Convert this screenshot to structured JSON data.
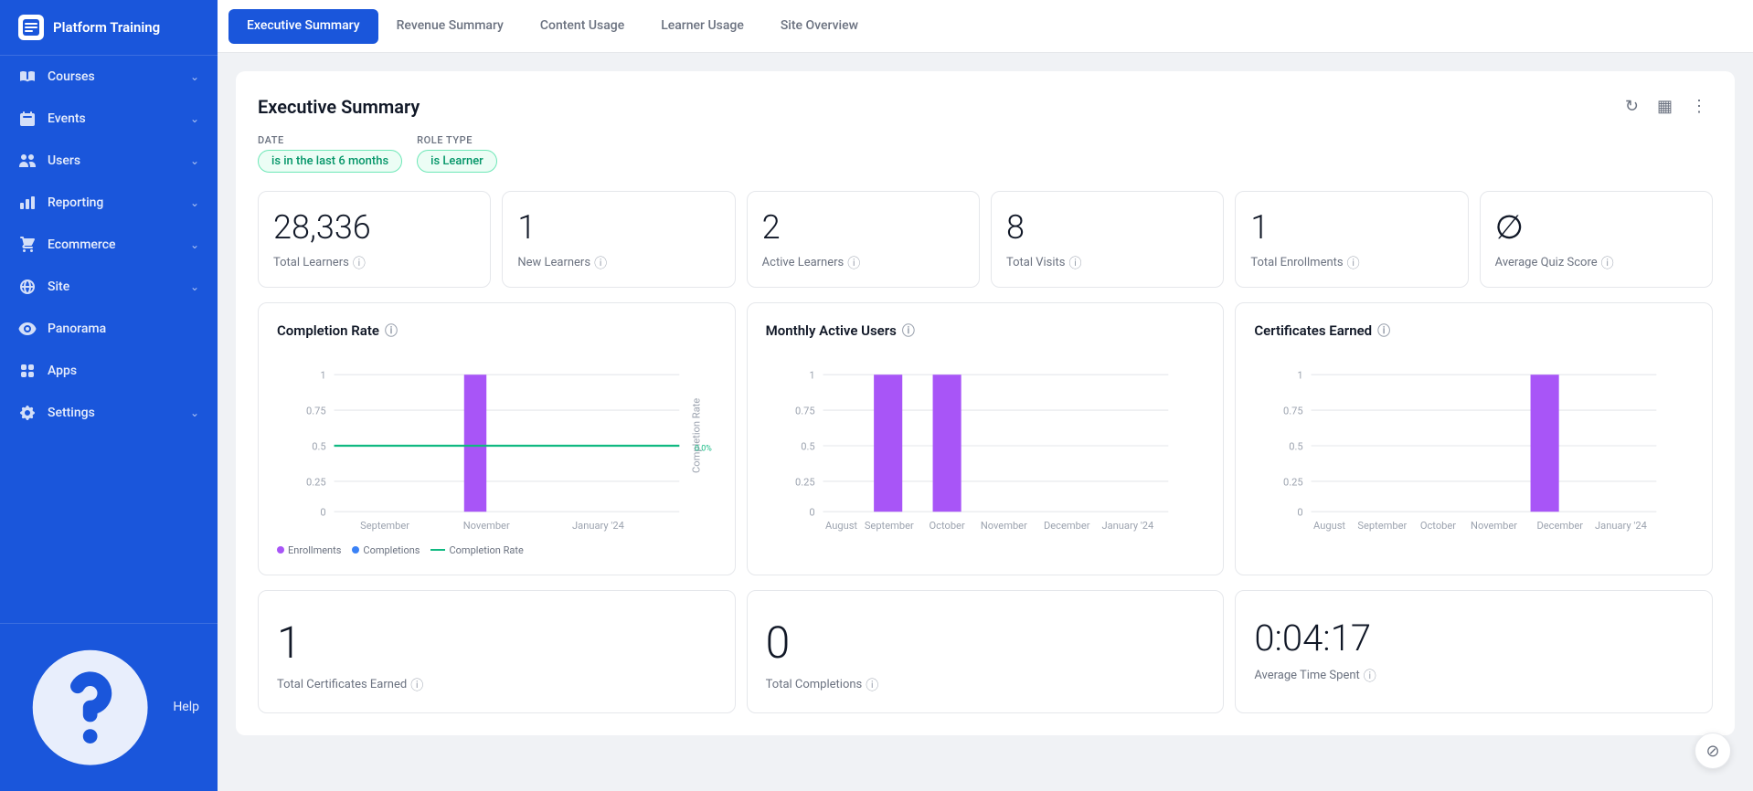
{
  "sidebar": {
    "title": "Platform Training",
    "items": [
      {
        "label": "Courses",
        "icon": "book",
        "hasChevron": true
      },
      {
        "label": "Events",
        "icon": "calendar",
        "hasChevron": true
      },
      {
        "label": "Users",
        "icon": "users",
        "hasChevron": true
      },
      {
        "label": "Reporting",
        "icon": "bar-chart",
        "hasChevron": true
      },
      {
        "label": "Ecommerce",
        "icon": "shopping-cart",
        "hasChevron": true
      },
      {
        "label": "Site",
        "icon": "globe",
        "hasChevron": true
      },
      {
        "label": "Panorama",
        "icon": "panorama",
        "hasChevron": false
      },
      {
        "label": "Apps",
        "icon": "grid",
        "hasChevron": false
      },
      {
        "label": "Settings",
        "icon": "settings",
        "hasChevron": true
      }
    ],
    "help_label": "Help"
  },
  "tabs": [
    {
      "label": "Executive Summary",
      "active": true
    },
    {
      "label": "Revenue Summary",
      "active": false
    },
    {
      "label": "Content Usage",
      "active": false
    },
    {
      "label": "Learner Usage",
      "active": false
    },
    {
      "label": "Site Overview",
      "active": false
    }
  ],
  "summary": {
    "title": "Executive Summary",
    "filters": {
      "date_label": "Date",
      "date_value": "is in the last 6 months",
      "role_label": "Role Type",
      "role_value": "is Learner"
    },
    "stats": [
      {
        "value": "28,336",
        "label": "Total Learners"
      },
      {
        "value": "1",
        "label": "New Learners"
      },
      {
        "value": "2",
        "label": "Active Learners"
      },
      {
        "value": "8",
        "label": "Total Visits"
      },
      {
        "value": "1",
        "label": "Total Enrollments"
      },
      {
        "value": "∅",
        "label": "Average Quiz Score"
      }
    ],
    "charts": [
      {
        "title": "Completion Rate",
        "type": "completion_rate",
        "x_labels": [
          "September",
          "November",
          "January '24"
        ],
        "legend": [
          "Enrollments",
          "Completions",
          "Completion Rate"
        ],
        "completion_rate_text": "0.0%"
      },
      {
        "title": "Monthly Active Users",
        "type": "monthly_active",
        "x_labels": [
          "August",
          "September",
          "October",
          "November",
          "December",
          "January '24"
        ]
      },
      {
        "title": "Certificates Earned",
        "type": "certificates",
        "x_labels": [
          "August",
          "September",
          "October",
          "November",
          "December",
          "January '24"
        ]
      }
    ],
    "bottom_stats": [
      {
        "value": "1",
        "label": "Total Certificates Earned"
      },
      {
        "value": "0",
        "label": "Total Completions"
      },
      {
        "value": "0:04:17",
        "label": "Average Time Spent"
      }
    ]
  }
}
